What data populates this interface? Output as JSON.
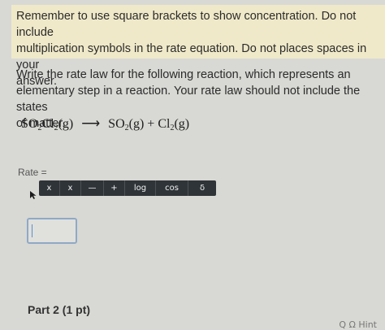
{
  "notice": {
    "line1": "Remember to use square brackets to show concentration. Do not include",
    "line2": "multiplication symbols in the rate equation. Do not places spaces in your",
    "line3": "answer."
  },
  "question": {
    "line1": "Write the rate law for the following reaction, which represents an",
    "line2": "elementary step in a reaction. Your rate law should not include the states",
    "line3": "of matter."
  },
  "equation": {
    "reactant_a": "SO",
    "reactant_a_sub1": "2",
    "reactant_a_b": "Cl",
    "reactant_a_sub2": "2",
    "reactant_state": "(g)",
    "arrow": "⟶",
    "product1": "SO",
    "product1_sub": "2",
    "product1_state": "(g)",
    "plus": "+",
    "product2": "Cl",
    "product2_sub": "2",
    "product2_state": "(g)"
  },
  "rate": {
    "label": "Rate ="
  },
  "toolbar": {
    "buttons": [
      "x",
      "x",
      "—",
      "+",
      "log",
      "cos",
      "δ"
    ]
  },
  "answer": {
    "value": ""
  },
  "part": {
    "label": "Part 2 (1 pt)"
  },
  "footer": {
    "partial_text": "Q  Ω  Hint"
  }
}
